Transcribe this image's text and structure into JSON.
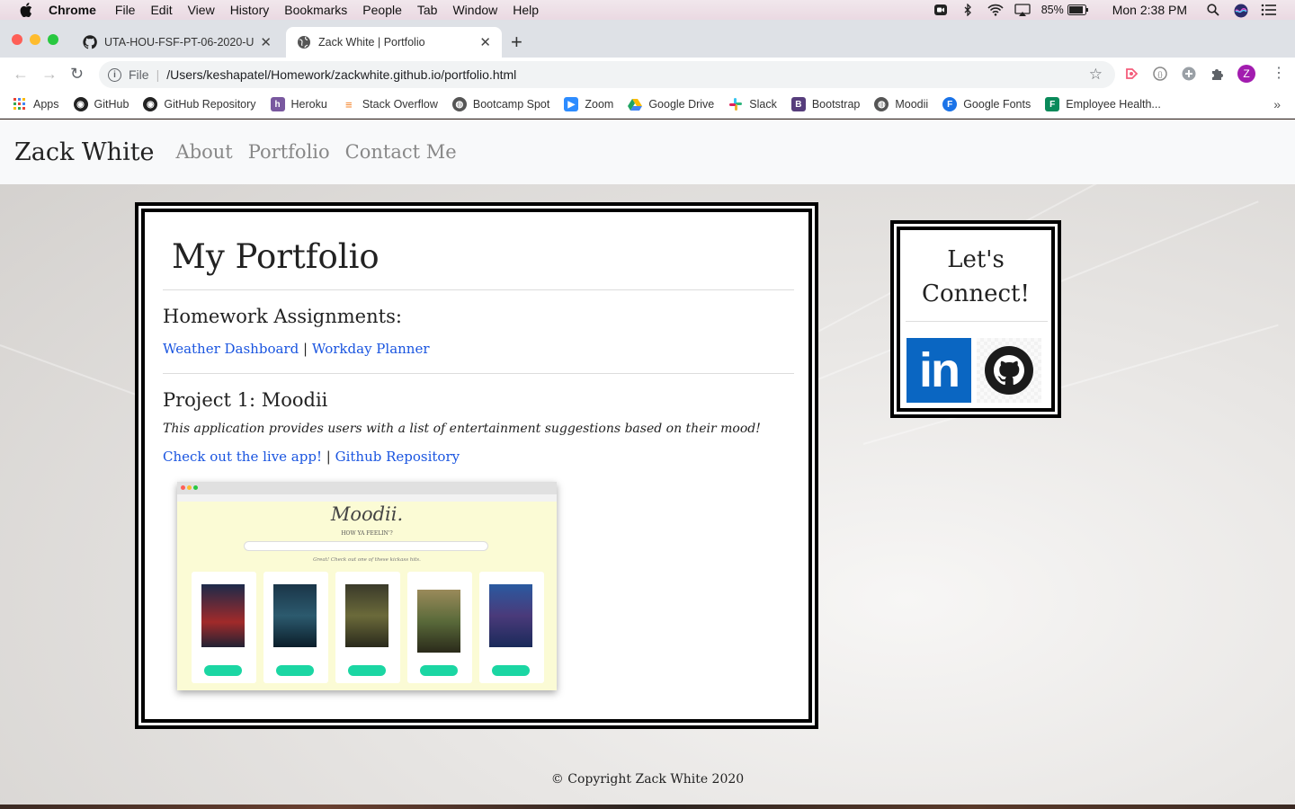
{
  "menubar": {
    "app": "Chrome",
    "items": [
      "File",
      "Edit",
      "View",
      "History",
      "Bookmarks",
      "People",
      "Tab",
      "Window",
      "Help"
    ],
    "battery": "85%",
    "clock": "Mon 2:38 PM"
  },
  "tabs": [
    {
      "title": "UTA-HOU-FSF-PT-06-2020-U",
      "icon": "github-icon"
    },
    {
      "title": "Zack White | Portfolio",
      "icon": "globe-icon"
    }
  ],
  "address": {
    "scheme": "File",
    "url": "/Users/keshapatel/Homework/zackwhite.github.io/portfolio.html"
  },
  "profile_initial": "Z",
  "bookmarks": [
    {
      "label": "Apps",
      "icon": "apps-grid-icon",
      "color": "#4285f4"
    },
    {
      "label": "GitHub",
      "icon": "github-icon",
      "color": "#222222"
    },
    {
      "label": "GitHub Repository",
      "icon": "github-icon",
      "color": "#222222"
    },
    {
      "label": "Heroku",
      "icon": "heroku-icon",
      "color": "#79589f"
    },
    {
      "label": "Stack Overflow",
      "icon": "stackoverflow-icon",
      "color": "#f48024"
    },
    {
      "label": "Bootcamp Spot",
      "icon": "globe-icon",
      "color": "#555555"
    },
    {
      "label": "Zoom",
      "icon": "zoom-icon",
      "color": "#2d8cff"
    },
    {
      "label": "Google Drive",
      "icon": "google-drive-icon",
      "color": "#1fa463"
    },
    {
      "label": "Slack",
      "icon": "slack-icon",
      "color": "#e01e5a"
    },
    {
      "label": "Bootstrap",
      "icon": "bootstrap-icon",
      "color": "#563d7c"
    },
    {
      "label": "Moodii",
      "icon": "globe-icon",
      "color": "#555555"
    },
    {
      "label": "Google Fonts",
      "icon": "google-fonts-icon",
      "color": "#1a73e8"
    },
    {
      "label": "Employee Health...",
      "icon": "forms-icon",
      "color": "#0a8a5a"
    }
  ],
  "site": {
    "brand": "Zack White",
    "nav": [
      "About",
      "Portfolio",
      "Contact Me"
    ],
    "footer": "© Copyright Zack White 2020"
  },
  "portfolio": {
    "title": "My Portfolio",
    "homework_heading": "Homework Assignments:",
    "homework_links": [
      "Weather Dashboard",
      "Workday Planner"
    ],
    "separator": "|",
    "project_heading": "Project 1: Moodii",
    "project_description": "This application provides users with a list of entertainment suggestions based on their mood!",
    "project_links": [
      "Check out the live app!",
      "Github Repository"
    ],
    "screenshot": {
      "logo": "Moodii.",
      "question": "HOW YA FEELIN'?",
      "note": "Great! Check out one of these kickass hits."
    }
  },
  "connect": {
    "title": "Let's Connect!",
    "linkedin_label": "in"
  }
}
